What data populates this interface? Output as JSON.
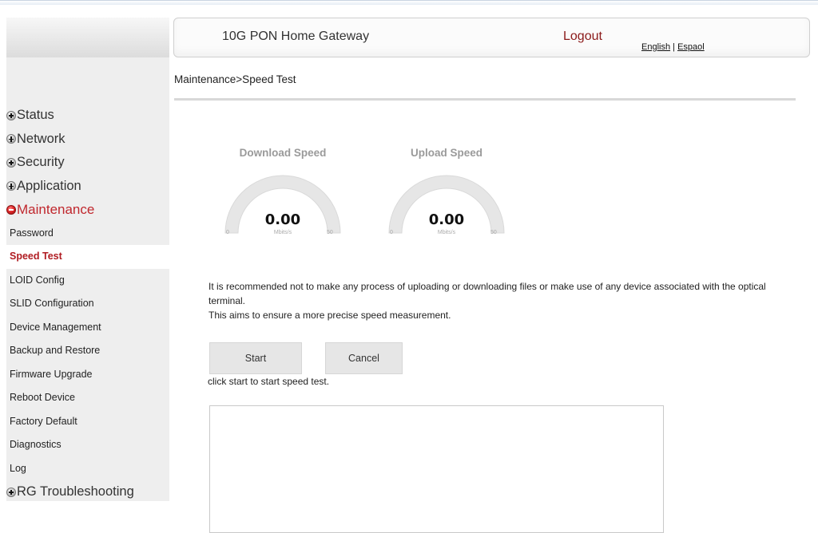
{
  "header": {
    "title": "10G PON Home Gateway",
    "logout_label": "Logout",
    "lang_english": "English",
    "lang_separator": "|",
    "lang_spanish": "Espaol"
  },
  "breadcrumb": "Maintenance>Speed Test",
  "sidebar": {
    "sections": [
      {
        "label": "Status",
        "icon": "plus-bullet-icon"
      },
      {
        "label": "Network",
        "icon": "plus-bullet-icon"
      },
      {
        "label": "Security",
        "icon": "plus-bullet-icon"
      },
      {
        "label": "Application",
        "icon": "plus-bullet-icon"
      },
      {
        "label": "Maintenance",
        "icon": "minus-bullet-icon"
      }
    ],
    "maintenance_items": [
      "Password",
      "Speed Test",
      "LOID Config",
      "SLID Configuration",
      "Device Management",
      "Backup and Restore",
      "Firmware Upgrade",
      "Reboot Device",
      "Factory Default",
      "Diagnostics",
      "Log"
    ],
    "active_item": "Speed Test",
    "last_section": {
      "label": "RG Troubleshooting",
      "icon": "plus-bullet-icon"
    }
  },
  "gauges": {
    "download": {
      "title": "Download Speed",
      "value": "0.00",
      "unit": "Mbits/s",
      "min": "0",
      "max": "50"
    },
    "upload": {
      "title": "Upload Speed",
      "value": "0.00",
      "unit": "Mbits/s",
      "min": "0",
      "max": "50"
    }
  },
  "note": {
    "line1": "It is recommended not to make any process of uploading or downloading files or make use of any device associated with the optical terminal.",
    "line2": "This aims to ensure a more precise speed measurement."
  },
  "buttons": {
    "start": "Start",
    "cancel": "Cancel"
  },
  "hint": "click start to start speed test.",
  "colors": {
    "accent_red": "#c0272d",
    "sidebar_bg": "#eeeeee",
    "gauge_track": "#e4e4e4"
  }
}
